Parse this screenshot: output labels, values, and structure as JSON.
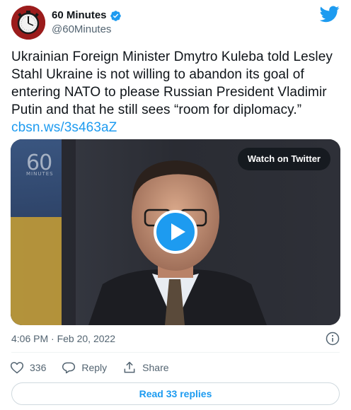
{
  "account": {
    "display_name": "60 Minutes",
    "handle": "@60Minutes",
    "verified_icon": "verified-badge-icon",
    "avatar_icon": "stopwatch-logo-icon"
  },
  "tweet": {
    "text": "Ukrainian Foreign Minister Dmytro Kuleba told Lesley Stahl Ukraine is not willing to abandon its goal of entering NATO to please Russian President Vladimir Putin and that he still sees “room for diplomacy.” ",
    "link": "cbsn.ws/3s463aZ",
    "timestamp": "4:06 PM · Feb 20, 2022"
  },
  "media": {
    "watermark_number": "60",
    "watermark_text": "MINUTES",
    "watch_label": "Watch on Twitter",
    "play_icon": "play-icon"
  },
  "actions": {
    "like_count": "336",
    "reply_label": "Reply",
    "share_label": "Share"
  },
  "read_replies_label": "Read 33 replies",
  "colors": {
    "accent": "#1d9bf0",
    "text": "#0f1419",
    "secondary": "#536471",
    "border": "#cfd9de"
  }
}
